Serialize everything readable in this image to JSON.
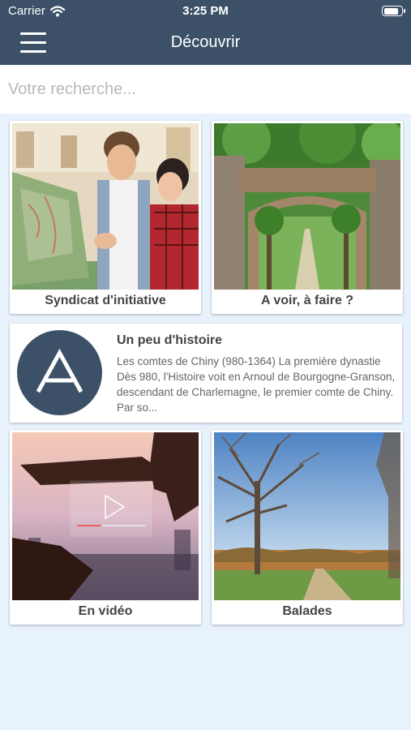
{
  "status_bar": {
    "carrier": "Carrier",
    "time": "3:25 PM",
    "battery_level": 0.85
  },
  "nav": {
    "title": "Découvrir"
  },
  "search": {
    "placeholder": "Votre recherche..."
  },
  "tiles": [
    {
      "label": "Syndicat d'initiative"
    },
    {
      "label": "A voir, à faire ?"
    },
    {
      "label": "En vidéo"
    },
    {
      "label": "Balades"
    }
  ],
  "history": {
    "logo_letter": "A",
    "title": "Un peu d'histoire",
    "text": "Les comtes de Chiny (980-1364) La première dynastie Dès 980, l'Histoire voit en Arnoul de Bourgogne-Granson, descendant de Charlemagne, le premier comte de Chiny. Par so..."
  },
  "colors": {
    "header": "#3c5168",
    "background": "#e8f2fc"
  }
}
